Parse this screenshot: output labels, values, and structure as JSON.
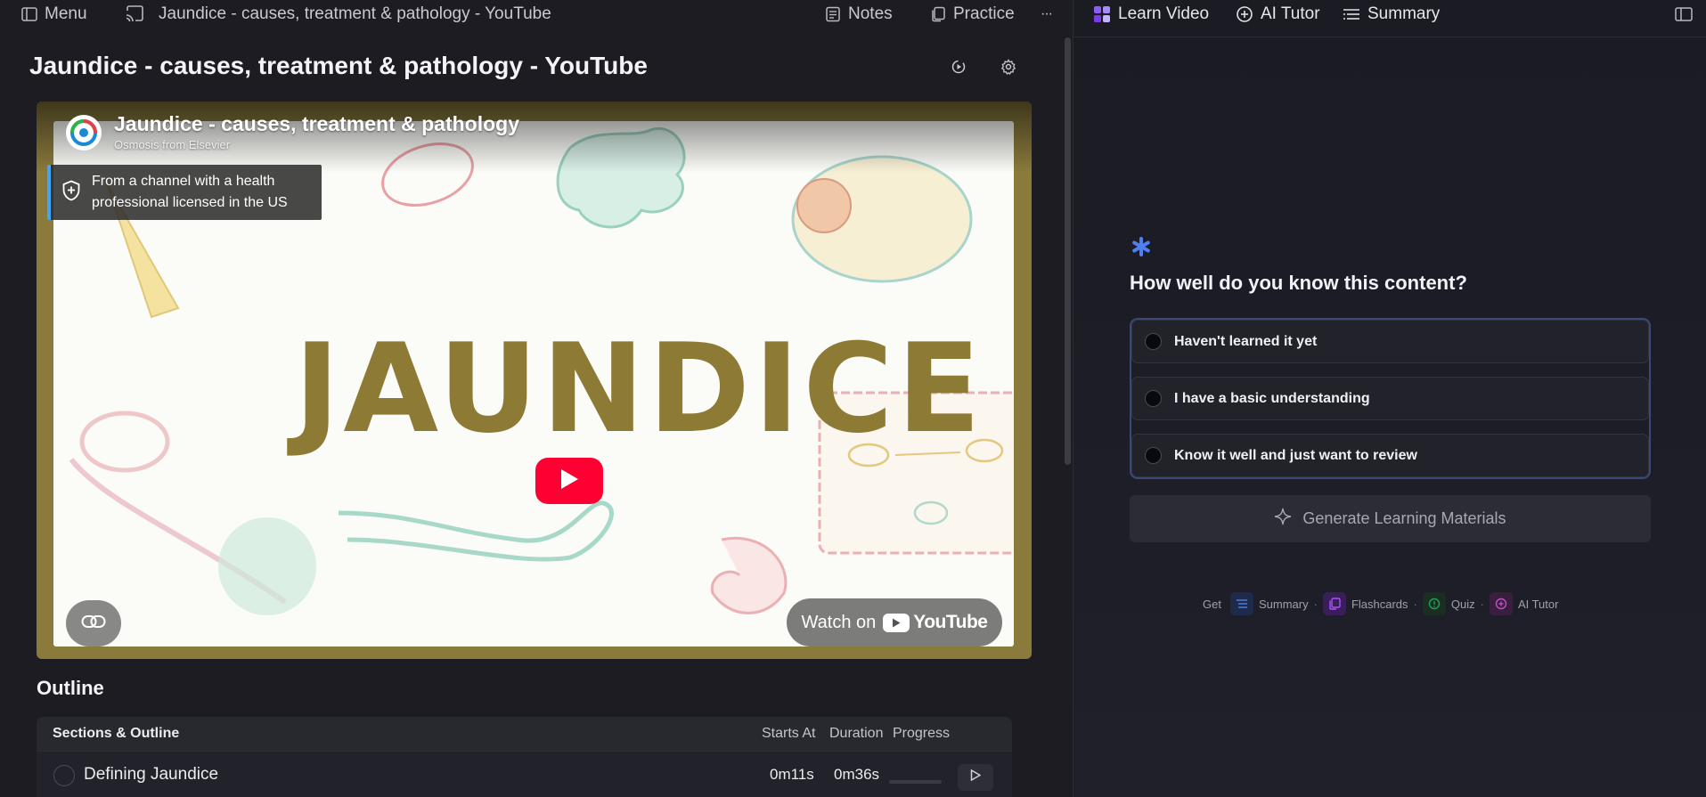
{
  "topbar": {
    "menu_label": "Menu",
    "doc_title": "Jaundice - causes, treatment & pathology - YouTube",
    "notes_label": "Notes",
    "practice_label": "Practice",
    "more_label": "···"
  },
  "right_tabs": {
    "learn_video": "Learn Video",
    "ai_tutor": "AI Tutor",
    "summary": "Summary"
  },
  "page": {
    "title": "Jaundice - causes, treatment & pathology - YouTube"
  },
  "video": {
    "title": "Jaundice - causes, treatment & pathology",
    "channel": "Osmosis from Elsevier",
    "health_badge": "From a channel with a health professional licensed in the US",
    "thumbnail_word": "JAUNDICE",
    "watch_on": "Watch on",
    "youtube": "YouTube"
  },
  "outline": {
    "heading": "Outline",
    "columns": {
      "sections": "Sections & Outline",
      "starts_at": "Starts At",
      "duration": "Duration",
      "progress": "Progress"
    },
    "rows": [
      {
        "title": "Defining Jaundice",
        "starts_at": "0m11s",
        "duration": "0m36s",
        "progress": 0
      }
    ]
  },
  "assessment": {
    "question": "How well do you know this content?",
    "options": [
      "Haven't learned it yet",
      "I have a basic understanding",
      "Know it well and just want to review"
    ],
    "generate_label": "Generate Learning Materials",
    "get_label": "Get",
    "get_items": [
      "Summary",
      "Flashcards",
      "Quiz",
      "AI Tutor"
    ],
    "sep": "·"
  },
  "colors": {
    "accent_blue": "#3b82f6",
    "youtube_red": "#ff0033",
    "thumb_gold": "#8d7a35"
  }
}
